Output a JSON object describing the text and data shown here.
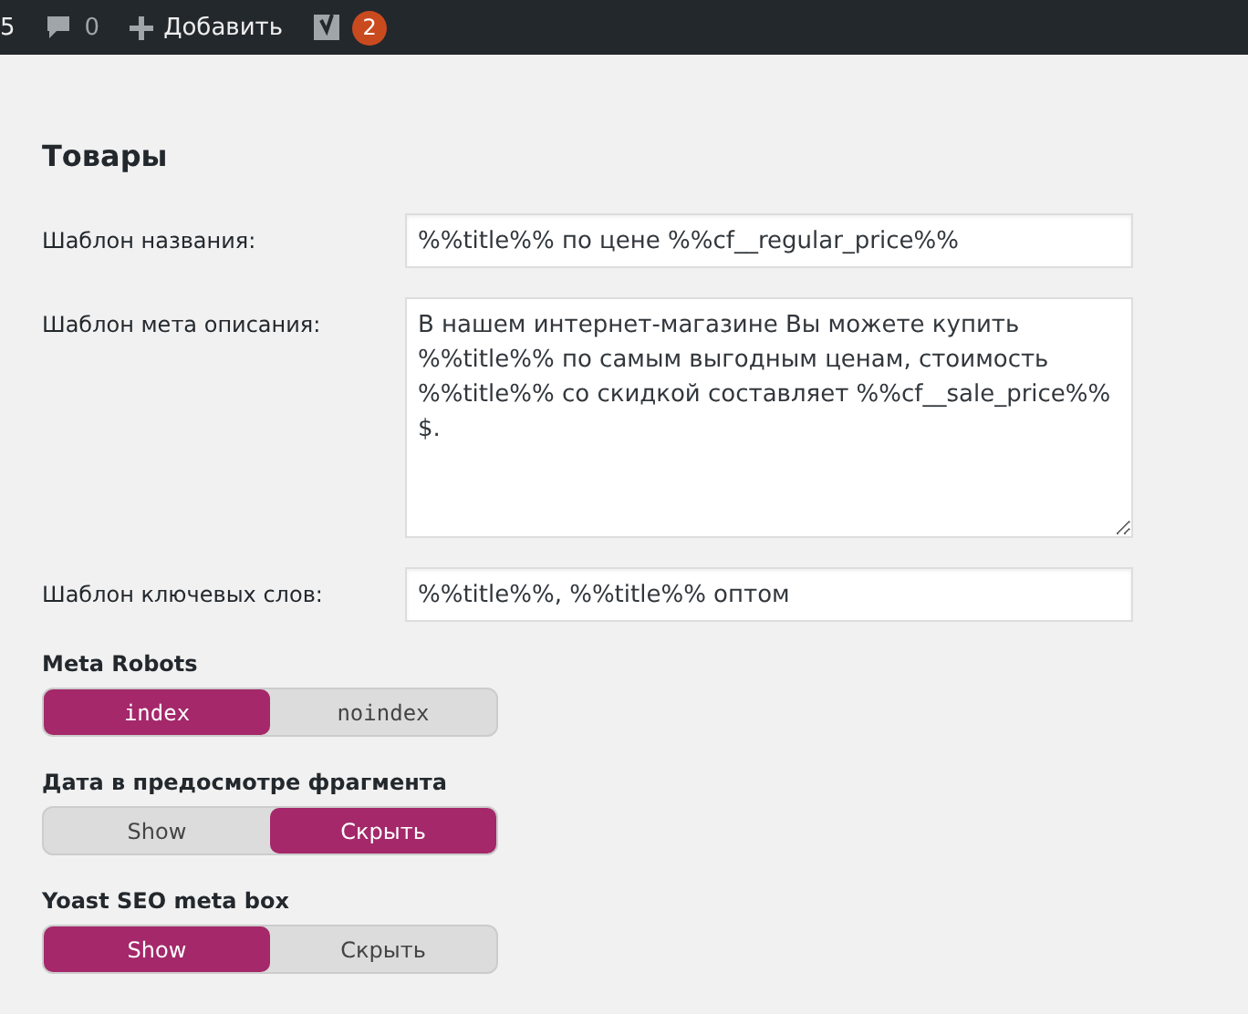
{
  "admin_bar": {
    "updates_count": "5",
    "comments_count": "0",
    "add_new": "Добавить",
    "notifications_count": "2"
  },
  "section": {
    "title": "Товары"
  },
  "fields": [
    {
      "kind": "input",
      "label": "Шаблон названия:",
      "value": "%%title%% по цене %%cf__regular_price%%"
    },
    {
      "kind": "textarea",
      "label": "Шаблон мета описания:",
      "value": "В нашем интернет-магазине Вы можете купить %%title%% по самым выгодным ценам, стоимость %%title%% со скидкой составляет %%cf__sale_price%% $."
    },
    {
      "kind": "input",
      "label": "Шаблон ключевых слов:",
      "value": "%%title%%, %%title%% оптом"
    }
  ],
  "toggles": [
    {
      "label": "Meta Robots",
      "kind": "mono",
      "options": [
        {
          "label": "index",
          "selected": true
        },
        {
          "label": "noindex",
          "selected": false
        }
      ]
    },
    {
      "label": "Дата в предосмотре фрагмента",
      "kind": "text",
      "options": [
        {
          "label": "Show",
          "selected": false
        },
        {
          "label": "Скрыть",
          "selected": true
        }
      ]
    },
    {
      "label": "Yoast SEO meta box",
      "kind": "text",
      "options": [
        {
          "label": "Show",
          "selected": true
        },
        {
          "label": "Скрыть",
          "selected": false
        }
      ]
    }
  ]
}
